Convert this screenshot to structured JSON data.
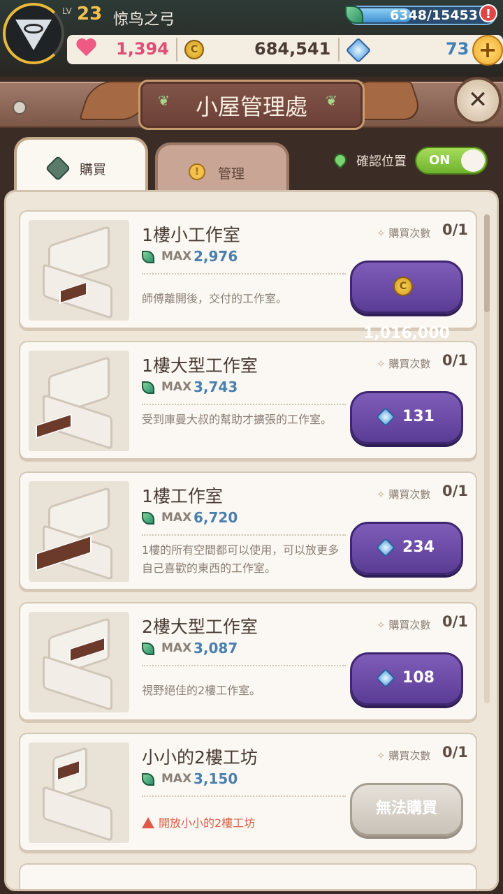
{
  "player": {
    "level_tag": "LV",
    "level": "23",
    "name": "惊鸟之弓"
  },
  "energy": {
    "text": "6348/15453",
    "fraction": 0.42,
    "alert": "!"
  },
  "resources": {
    "hearts": "1,394",
    "coins": "684,541",
    "gems": "73",
    "plus": "+"
  },
  "header": {
    "title": "小屋管理處",
    "close": "✕"
  },
  "tabs": [
    {
      "label": "購買",
      "active": true
    },
    {
      "label": "管理",
      "active": false
    }
  ],
  "location": {
    "label": "確認位置",
    "toggle": "ON"
  },
  "count_label": "購買次數",
  "max_label": "MAX",
  "coin_glyph": "C",
  "items": [
    {
      "title": "1樓小工作室",
      "max": "2,976",
      "desc": "師傅離開後，交付的工作室。",
      "count": "0/1",
      "price": "1,016,000",
      "currency": "coin"
    },
    {
      "title": "1樓大型工作室",
      "max": "3,743",
      "desc": "受到庫曼大叔的幫助才擴張的工作室。",
      "count": "0/1",
      "price": "131",
      "currency": "gem"
    },
    {
      "title": "1樓工作室",
      "max": "6,720",
      "desc": "1樓的所有空間都可以使用，可以放更多自己喜歡的東西的工作室。",
      "count": "0/1",
      "price": "234",
      "currency": "gem"
    },
    {
      "title": "2樓大型工作室",
      "max": "3,087",
      "desc": "視野絕佳的2樓工作室。",
      "count": "0/1",
      "price": "108",
      "currency": "gem"
    },
    {
      "title": "小小的2樓工坊",
      "max": "3,150",
      "warning": "開放小小的2樓工坊",
      "count": "0/1",
      "price": "無法購買",
      "currency": "disabled"
    }
  ],
  "colors": {
    "accent_purple": "#5b3c95",
    "energy_blue": "#3f8fd0",
    "toggle_green": "#6fb22e"
  }
}
